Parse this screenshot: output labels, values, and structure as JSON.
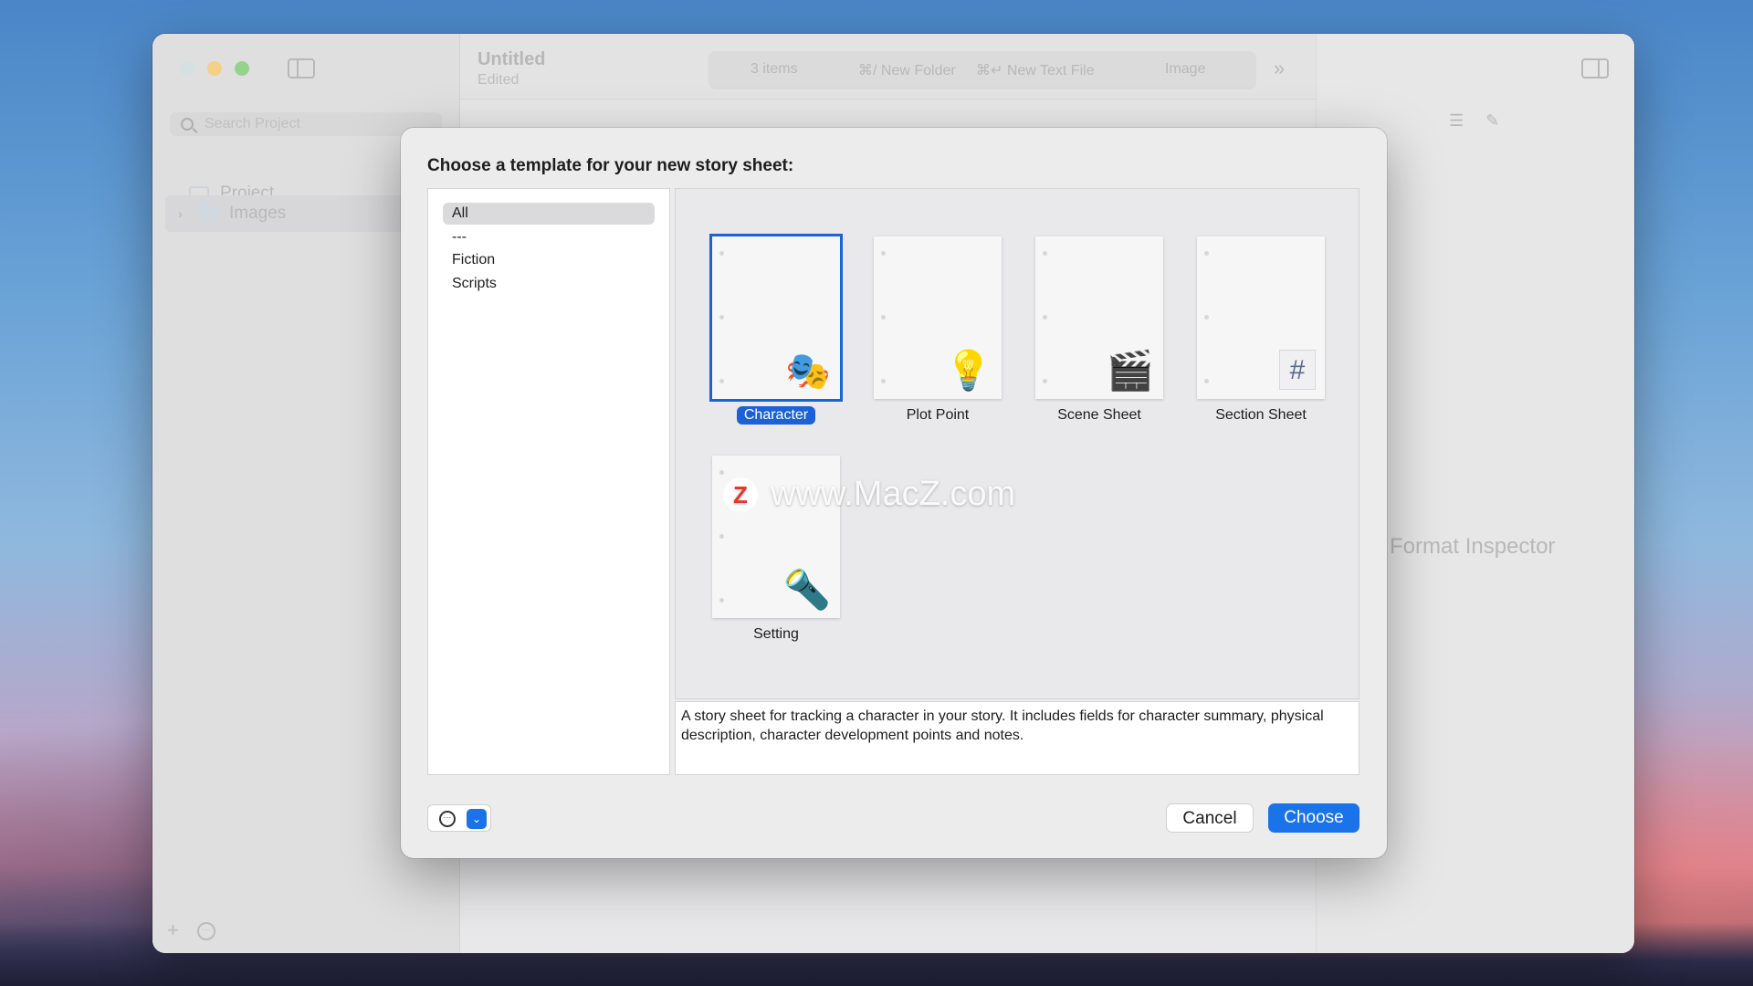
{
  "window": {
    "title": "Untitled",
    "subtitle": "Edited",
    "search_placeholder": "Search Project",
    "sidebar": {
      "project_label": "Project",
      "images_label": "Images"
    },
    "toolbar": {
      "items_count": "3 items",
      "new_folder": "⌘/ New Folder",
      "new_text_file": "⌘↵ New Text File",
      "image": "Image"
    },
    "inspector_placeholder": "o Format Inspector"
  },
  "dialog": {
    "title": "Choose a template for your new story sheet:",
    "categories": [
      {
        "label": "All",
        "selected": true
      },
      {
        "label": "---",
        "selected": false
      },
      {
        "label": "Fiction",
        "selected": false
      },
      {
        "label": "Scripts",
        "selected": false
      }
    ],
    "templates": [
      {
        "label": "Character",
        "icon": "theater-masks-icon",
        "selected": true
      },
      {
        "label": "Plot Point",
        "icon": "light-bulb-icon",
        "selected": false
      },
      {
        "label": "Scene Sheet",
        "icon": "clapperboard-icon",
        "selected": false
      },
      {
        "label": "Section Sheet",
        "icon": "hash-icon",
        "selected": false
      },
      {
        "label": "Setting",
        "icon": "spotlight-icon",
        "selected": false
      }
    ],
    "description": "A story sheet for tracking a character in your story. It includes fields for character summary, physical description, character development points and notes.",
    "cancel_label": "Cancel",
    "choose_label": "Choose"
  },
  "watermark": {
    "logo_letter": "Z",
    "text": "www.MacZ.com"
  },
  "colors": {
    "accent": "#1a73e8",
    "selection": "#1a62d6"
  }
}
